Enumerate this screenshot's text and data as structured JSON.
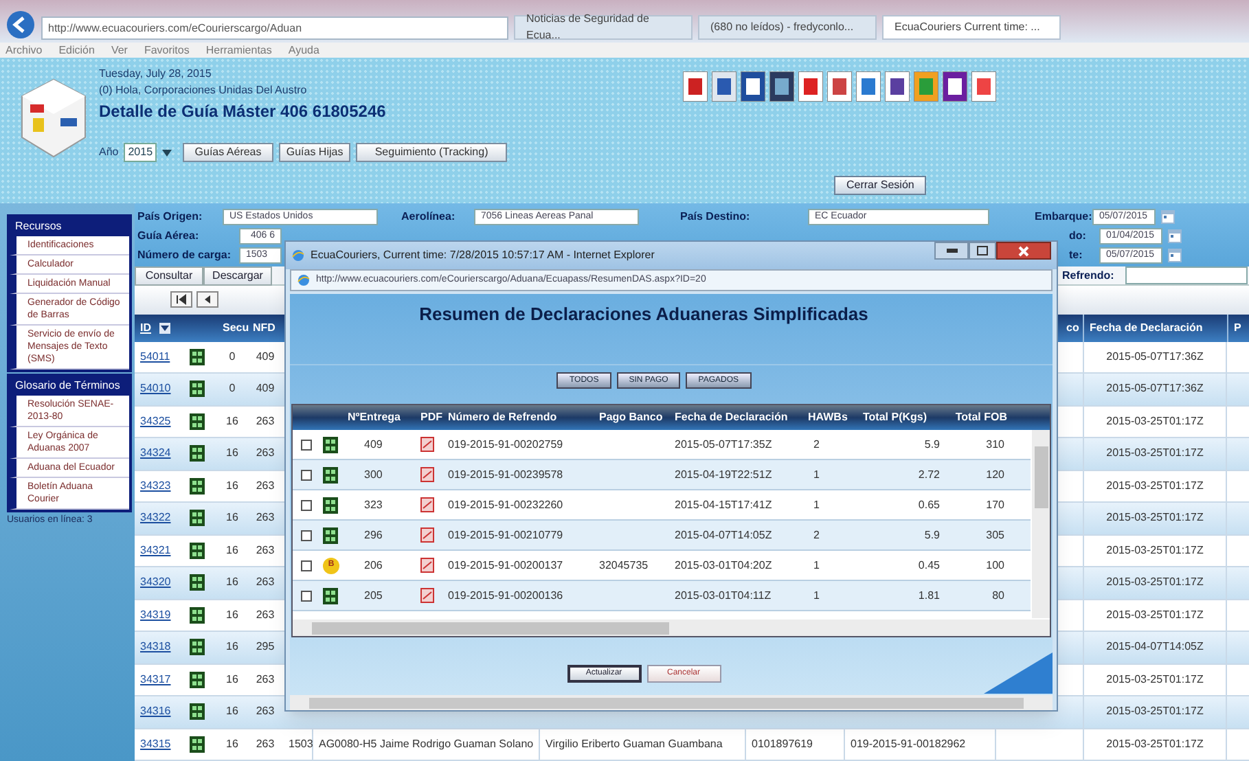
{
  "browser": {
    "address": "http://www.ecuacouriers.com/eCourierscargo/Aduan",
    "tabs": [
      {
        "label": "Noticias de Seguridad de Ecua...",
        "selected": false
      },
      {
        "label": "(680 no leídos) - fredyconlo...",
        "selected": false
      },
      {
        "label": "EcuaCouriers Current time: ...",
        "selected": true
      }
    ],
    "menu": [
      "Archivo",
      "Edición",
      "Ver",
      "Favoritos",
      "Herramientas",
      "Ayuda"
    ]
  },
  "banner": {
    "date": "Tuesday, July 28, 2015",
    "greeting": "(0) Hola, Corporaciones Unidas Del Austro",
    "title": "Detalle de Guía Máster 406 61805246",
    "year_label": "Año",
    "year": "2015",
    "buttons": [
      "Guías Aéreas",
      "Guías Hijas",
      "Seguimiento (Tracking)"
    ],
    "logout": "Cerrar Sesión"
  },
  "sidebar": {
    "sections": [
      {
        "title": "Recursos",
        "items": [
          "Identificaciones",
          "Calculador",
          "Liquidación Manual",
          "Generador de Código de Barras",
          "Servicio de envío de Mensajes de Texto (SMS)"
        ]
      },
      {
        "title": "Glosario de Términos",
        "items": [
          "Resolución SENAE-2013-80",
          "Ley Orgánica de Aduanas 2007",
          "Aduana del Ecuador",
          "Boletín Aduana Courier"
        ]
      }
    ],
    "online": "Usuarios en línea: 3"
  },
  "form": {
    "origin_label": "País Origen:",
    "origin": "US Estados Unidos",
    "airline_label": "Aerolínea:",
    "airline": "7056 Lineas Aereas Panal",
    "dest_label": "País Destino:",
    "dest": "EC Ecuador",
    "ship_label": "Embarque:",
    "ship": "05/07/2015",
    "guide_label": "Guía Aérea:",
    "guide": "406 6",
    "from_label": "do:",
    "from": "01/04/2015",
    "cargo_label": "Número de carga:",
    "cargo": "1503",
    "to_label": "te:",
    "to": "05/07/2015",
    "buttons": [
      "Consultar",
      "Descargar"
    ],
    "refrendo_label": "Refrendo:"
  },
  "table": {
    "columns": [
      "ID",
      "Secu",
      "NFD",
      "co",
      "Fecha de Declaración",
      "P"
    ],
    "rows": [
      {
        "id": "54011",
        "secu": "0",
        "nfd": "409",
        "fecha": "2015-05-07T17:36Z"
      },
      {
        "id": "54010",
        "secu": "0",
        "nfd": "409",
        "fecha": "2015-05-07T17:36Z"
      },
      {
        "id": "34325",
        "secu": "16",
        "nfd": "263",
        "fecha": "2015-03-25T01:17Z"
      },
      {
        "id": "34324",
        "secu": "16",
        "nfd": "263",
        "fecha": "2015-03-25T01:17Z"
      },
      {
        "id": "34323",
        "secu": "16",
        "nfd": "263",
        "fecha": "2015-03-25T01:17Z"
      },
      {
        "id": "34322",
        "secu": "16",
        "nfd": "263",
        "fecha": "2015-03-25T01:17Z"
      },
      {
        "id": "34321",
        "secu": "16",
        "nfd": "263",
        "fecha": "2015-03-25T01:17Z"
      },
      {
        "id": "34320",
        "secu": "16",
        "nfd": "263",
        "fecha": "2015-03-25T01:17Z"
      },
      {
        "id": "34319",
        "secu": "16",
        "nfd": "263",
        "fecha": "2015-03-25T01:17Z"
      },
      {
        "id": "34318",
        "secu": "16",
        "nfd": "295",
        "fecha": "2015-04-07T14:05Z"
      },
      {
        "id": "34317",
        "secu": "16",
        "nfd": "263",
        "fecha": "2015-03-25T01:17Z"
      },
      {
        "id": "34316",
        "secu": "16",
        "nfd": "263",
        "fecha": "2015-03-25T01:17Z"
      },
      {
        "id": "34315",
        "secu": "16",
        "nfd": "263",
        "fecha": "2015-03-25T01:17Z",
        "extra": [
          "1503",
          "AG0080-H5 Jaime Rodrigo Guaman Solano",
          "Virgilio Eriberto Guaman Guambana",
          "0101897619",
          "019-2015-91-00182962"
        ]
      }
    ]
  },
  "popup": {
    "title": "EcuaCouriers, Current time: 7/28/2015 10:57:17 AM - Internet Explorer",
    "address": "http://www.ecuacouriers.com/eCourierscargo/Aduana/Ecuapass/ResumenDAS.aspx?ID=20",
    "heading": "Resumen de Declaraciones Aduaneras Simplificadas",
    "filters": [
      "TODOS",
      "SIN PAGO",
      "PAGADOS"
    ],
    "columns": [
      "NºEntrega",
      "PDF",
      "Número de Refrendo",
      "Pago Banco",
      "Fecha de Declaración",
      "HAWBs",
      "Total P(Kgs)",
      "Total FOB"
    ],
    "rows": [
      {
        "kind": "grid",
        "checked": false,
        "entrega": "409",
        "refrendo": "019-2015-91-00202759",
        "fecha": "2015-05-07T17:35Z",
        "hawbs": "2",
        "peso": "5.9",
        "fob": "310"
      },
      {
        "kind": "grid",
        "checked": false,
        "entrega": "300",
        "refrendo": "019-2015-91-00239578",
        "fecha": "2015-04-19T22:51Z",
        "hawbs": "1",
        "peso": "2.72",
        "fob": "120"
      },
      {
        "kind": "grid",
        "checked": false,
        "entrega": "323",
        "refrendo": "019-2015-91-00232260",
        "fecha": "2015-04-15T17:41Z",
        "hawbs": "1",
        "peso": "0.65",
        "fob": "170"
      },
      {
        "kind": "grid",
        "checked": false,
        "entrega": "296",
        "refrendo": "019-2015-91-00210779",
        "fecha": "2015-04-07T14:05Z",
        "hawbs": "2",
        "peso": "5.9",
        "fob": "305"
      },
      {
        "kind": "badge",
        "badge": "B",
        "checked": false,
        "entrega": "206",
        "refrendo": "019-2015-91-00200137",
        "banco": "32045735",
        "fecha": "2015-03-01T04:20Z",
        "hawbs": "1",
        "peso": "0.45",
        "fob": "100"
      },
      {
        "kind": "grid",
        "checked": false,
        "entrega": "205",
        "refrendo": "019-2015-91-00200136",
        "fecha": "2015-03-01T04:11Z",
        "hawbs": "1",
        "peso": "1.81",
        "fob": "80"
      }
    ],
    "buttons": [
      "Actualizar",
      "Cancelar"
    ]
  }
}
